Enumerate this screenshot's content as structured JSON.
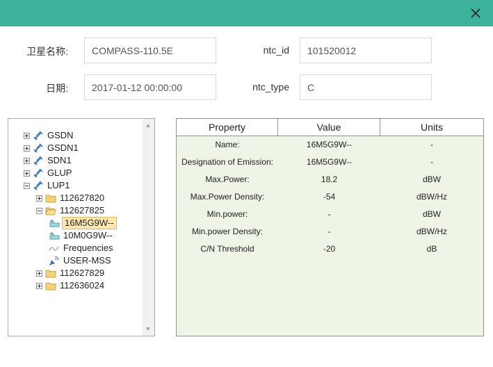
{
  "dialog": {
    "close_icon": "close-icon",
    "header_color": "#3eb39b"
  },
  "form": {
    "satellite_name_label": "卫星名称:",
    "satellite_name_value": "COMPASS-110.5E",
    "ntc_id_label": "ntc_id",
    "ntc_id_value": "101520012",
    "date_label": "日期:",
    "date_value": "2017-01-12 00:00:00",
    "ntc_type_label": "ntc_type",
    "ntc_type_value": "C"
  },
  "tree": {
    "nodes": [
      {
        "label": "GSDN",
        "icon": "satellite-icon",
        "expander": "plus"
      },
      {
        "label": "GSDN1",
        "icon": "satellite-icon",
        "expander": "plus"
      },
      {
        "label": "SDN1",
        "icon": "satellite-icon",
        "expander": "plus"
      },
      {
        "label": "GLUP",
        "icon": "satellite-icon",
        "expander": "plus"
      },
      {
        "label": "LUP1",
        "icon": "satellite-icon",
        "expander": "minus"
      },
      {
        "label": "112627820",
        "icon": "folder-icon",
        "expander": "plus"
      },
      {
        "label": "112627825",
        "icon": "folder-open-icon",
        "expander": "minus"
      },
      {
        "label": "16M5G9W--",
        "icon": "emission-icon",
        "selected": true
      },
      {
        "label": "10M0G9W--",
        "icon": "emission-icon"
      },
      {
        "label": "Frequencies",
        "icon": "frequency-wave-icon"
      },
      {
        "label": "USER-MSS",
        "icon": "antenna-icon"
      },
      {
        "label": "112627829",
        "icon": "folder-icon",
        "expander": "plus"
      },
      {
        "label": "112636024",
        "icon": "folder-icon",
        "expander": "plus"
      }
    ]
  },
  "properties": {
    "columns": [
      "Property",
      "Value",
      "Units"
    ],
    "rows": [
      {
        "property": "Name:",
        "value": "16M5G9W--",
        "units": "-"
      },
      {
        "property": "Designation of Emission:",
        "value": "16M5G9W--",
        "units": "-"
      },
      {
        "property": "Max.Power:",
        "value": "18.2",
        "units": "dBW"
      },
      {
        "property": "Max.Power Density:",
        "value": "-54",
        "units": "dBW/Hz"
      },
      {
        "property": "Min.power:",
        "value": "-",
        "units": "dBW"
      },
      {
        "property": "Min.power Density:",
        "value": "-",
        "units": "dBW/Hz"
      },
      {
        "property": "C/N Threshold",
        "value": "-20",
        "units": "dB"
      }
    ]
  }
}
